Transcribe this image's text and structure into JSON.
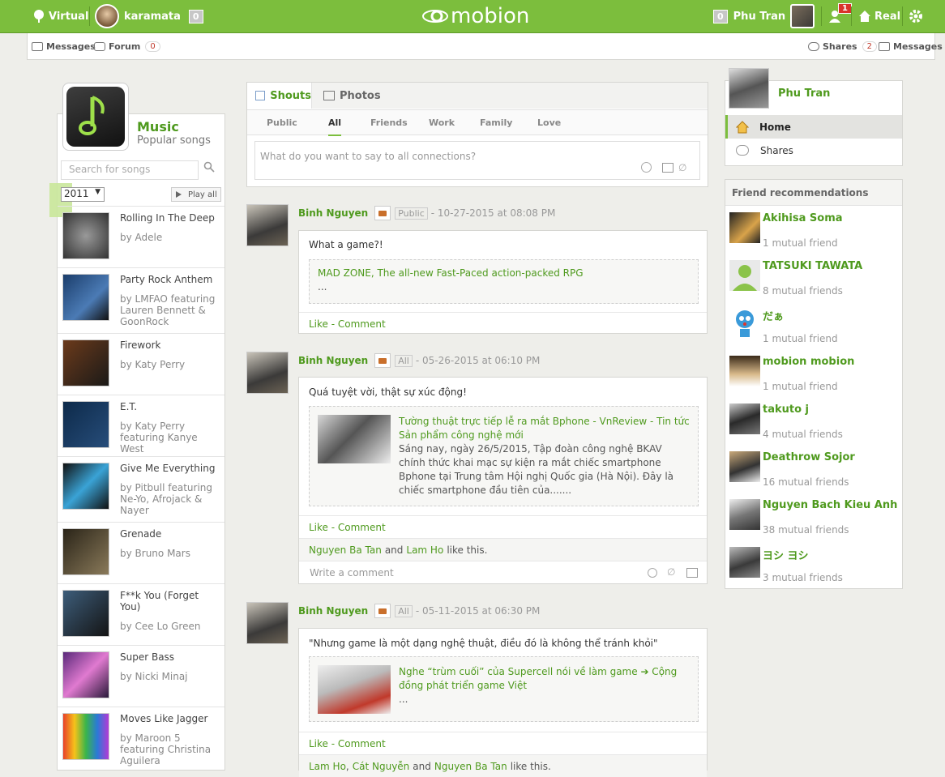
{
  "topbar": {
    "virtual_label": "Virtual",
    "user_name": "karamata",
    "user_badge": "0",
    "logo_text": "mobion",
    "right_badge": "0",
    "right_user": "Phu Tran",
    "notif_count": "1",
    "real_label": "Real"
  },
  "subbar": {
    "messages_label": "Messages",
    "forum_label": "Forum",
    "forum_count": "0",
    "shares_label": "Shares",
    "shares_count": "2",
    "messages_right_label": "Messages"
  },
  "music": {
    "title": "Music",
    "subtitle": "Popular songs",
    "search_placeholder": "Search for songs",
    "year": "2011",
    "play_all": "Play all",
    "songs": [
      {
        "title": "Rolling In The Deep",
        "artist": "by Adele"
      },
      {
        "title": "Party Rock Anthem",
        "artist": "by LMFAO featuring Lauren Bennett & GoonRock"
      },
      {
        "title": "Firework",
        "artist": "by Katy Perry"
      },
      {
        "title": "E.T.",
        "artist": "by Katy Perry featuring Kanye West"
      },
      {
        "title": "Give Me Everything",
        "artist": "by Pitbull featuring Ne-Yo, Afrojack & Nayer"
      },
      {
        "title": "Grenade",
        "artist": "by Bruno Mars"
      },
      {
        "title": "F**k You (Forget You)",
        "artist": "by Cee Lo Green"
      },
      {
        "title": "Super Bass",
        "artist": "by Nicki Minaj"
      },
      {
        "title": "Moves Like Jagger",
        "artist": "by Maroon 5 featuring Christina Aguilera"
      }
    ]
  },
  "composer": {
    "tabs": [
      "Shouts",
      "Photos"
    ],
    "filters": [
      "Public",
      "All",
      "Friends",
      "Work",
      "Family",
      "Love"
    ],
    "active_filter": "All",
    "placeholder": "What do you want to say to all connections?"
  },
  "posts": [
    {
      "author": "Binh Nguyen",
      "privacy": "Public",
      "date": "- 10-27-2015 at 08:08 PM",
      "text": "What a game?!",
      "link_title": "MAD ZONE, The all-new Fast-Paced action-packed RPG",
      "link_desc": "...",
      "actions": "Like  - Comment"
    },
    {
      "author": "Binh Nguyen",
      "privacy": "All",
      "date": "- 05-26-2015 at 06:10 PM",
      "text": "Quá tuyệt vời, thật sự xúc động!",
      "link_title": "Tường thuật trực tiếp lễ ra mắt Bphone - VnReview - Tin tức Sản phẩm công nghệ mới",
      "link_desc": "Sáng nay, ngày 26/5/2015, Tập đoàn công nghệ BKAV chính thức khai mạc sự kiện ra mắt chiếc smartphone Bphone tại Trung tâm Hội nghị Quốc gia (Hà Nội). Đây là chiếc smartphone đầu tiên của.......",
      "actions": "Like  - Comment",
      "likers": [
        "Nguyen Ba Tan",
        "Lam Ho"
      ],
      "likes_join": "and",
      "likes_suffix": "like this.",
      "comment_placeholder": "Write a comment"
    },
    {
      "author": "Binh Nguyen",
      "privacy": "All",
      "date": "- 05-11-2015 at 06:30 PM",
      "text": "\"Nhưng game là một dạng nghệ thuật, điều đó là không thể tránh khỏi\"",
      "link_title": "Nghe “trùm cuối” của Supercell nói về làm game ➔ Cộng đồng phát triển game Việt",
      "link_desc": "...",
      "actions": "Like  - Comment",
      "likers": [
        "Lam Ho",
        "Cát Nguyễn",
        "Nguyen Ba Tan"
      ],
      "likes_comma": ",",
      "likes_join": "and",
      "likes_suffix": "like this."
    }
  ],
  "profile": {
    "name": "Phu Tran",
    "nav_home": "Home",
    "nav_shares": "Shares"
  },
  "recommendations": {
    "title": "Friend recommendations",
    "items": [
      {
        "name": "Akihisa Soma",
        "mutual": "1 mutual friend"
      },
      {
        "name": "TATSUKI TAWATA",
        "mutual": "8 mutual friends"
      },
      {
        "name": "だぁ",
        "mutual": "1 mutual friend"
      },
      {
        "name": "mobion mobion",
        "mutual": "1 mutual friend"
      },
      {
        "name": "takuto j",
        "mutual": "4 mutual friends"
      },
      {
        "name": "Deathrow Sojor",
        "mutual": "16 mutual friends"
      },
      {
        "name": "Nguyen Bach Kieu Anh",
        "mutual": "38 mutual friends"
      },
      {
        "name": "ヨシ ヨシ",
        "mutual": "3 mutual friends"
      }
    ]
  },
  "colors": {
    "brand_green": "#7cbe3d",
    "link_green": "#4f9a1e",
    "notif_red": "#d9342b"
  }
}
